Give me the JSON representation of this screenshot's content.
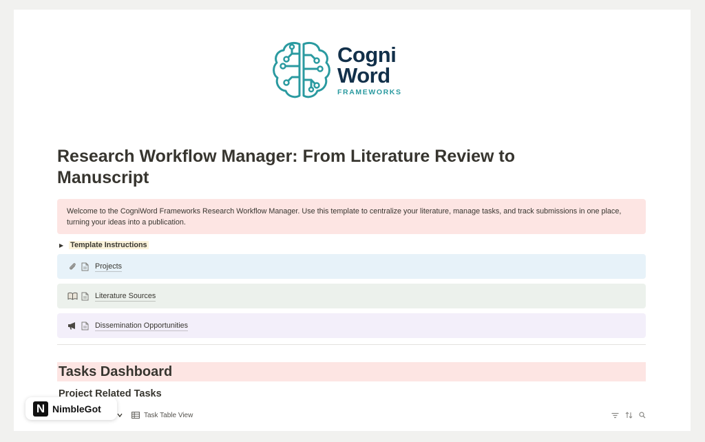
{
  "logo": {
    "line1": "Cogni",
    "line2": "Word",
    "line3": "FRAMEWORKS",
    "icon": "brain-circuit-icon",
    "color_primary": "#12304a",
    "color_accent": "#2a9aa0"
  },
  "page": {
    "title": "Research Workflow Manager: From Literature Review to Manuscript",
    "callout": "Welcome to the CogniWord Frameworks Research Workflow Manager. Use this template to centralize your literature, manage tasks, and track submissions in one place, turning your ideas into a publication.",
    "toggle_label": "Template Instructions"
  },
  "links": [
    {
      "emoji_icon": "paperclip-icon",
      "page_icon": "page-icon",
      "label": "Projects",
      "bg": "#e7f2f9"
    },
    {
      "emoji_icon": "open-book-icon",
      "page_icon": "page-icon",
      "label": "Literature Sources",
      "bg": "#ecf1ec"
    },
    {
      "emoji_icon": "megaphone-icon",
      "page_icon": "page-icon",
      "label": "Dissemination Opportunities",
      "bg": "#f3effa"
    }
  ],
  "dashboard": {
    "heading": "Tasks Dashboard",
    "subheading": "Project Related Tasks",
    "view_tab": "Task Table View",
    "tools": [
      "filter-icon",
      "sort-icon",
      "search-icon"
    ]
  },
  "badge": {
    "mark": "N",
    "text": "NimbleGot"
  }
}
